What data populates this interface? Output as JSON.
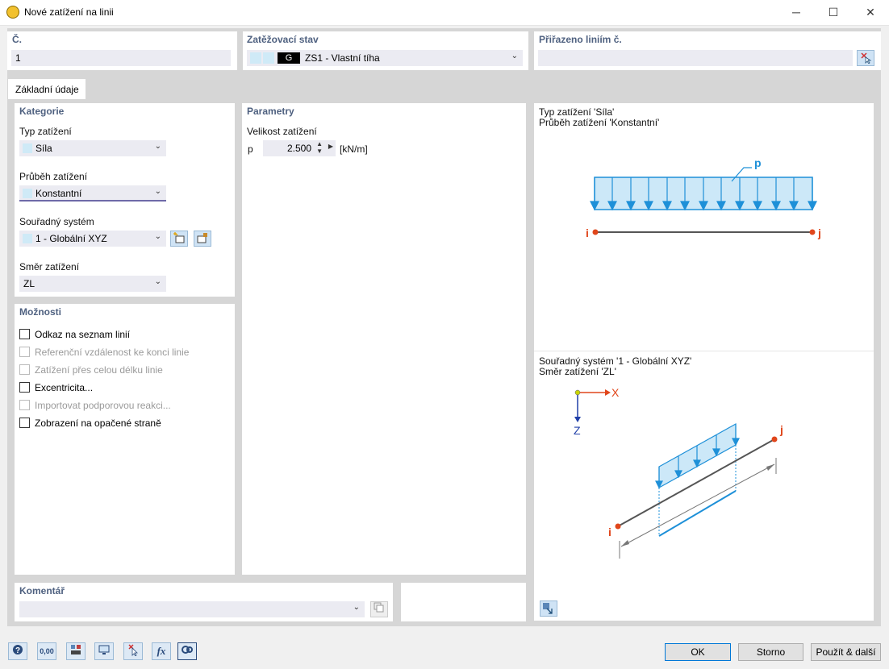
{
  "window": {
    "title": "Nové zatížení na linii",
    "minimize": "─",
    "maximize": "☐",
    "close": "✕"
  },
  "header": {
    "no_label": "Č.",
    "no_value": "1",
    "loadcase_label": "Zatěžovací stav",
    "loadcase_tag": "G",
    "loadcase_value": "ZS1 - Vlastní tíha",
    "assigned_label": "Přiřazeno liniím č.",
    "assigned_value": ""
  },
  "tab": {
    "label": "Základní údaje"
  },
  "category": {
    "title": "Kategorie",
    "load_type_label": "Typ zatížení",
    "load_type_value": "Síla",
    "distribution_label": "Průběh zatížení",
    "distribution_value": "Konstantní",
    "coord_label": "Souřadný systém",
    "coord_value": "1 - Globální XYZ",
    "direction_label": "Směr zatížení",
    "direction_value": "ZL"
  },
  "options": {
    "title": "Možnosti",
    "items": [
      {
        "label": "Odkaz na seznam linií",
        "enabled": true
      },
      {
        "label": "Referenční vzdálenost ke konci linie",
        "enabled": false
      },
      {
        "label": "Zatížení přes celou délku linie",
        "enabled": false
      },
      {
        "label": "Excentricita...",
        "enabled": true
      },
      {
        "label": "Importovat podporovou reakci...",
        "enabled": false
      },
      {
        "label": "Zobrazení na opačené straně",
        "enabled": true
      }
    ]
  },
  "parameters": {
    "title": "Parametry",
    "magnitude_label": "Velikost zatížení",
    "symbol": "p",
    "value": "2.500",
    "unit": "[kN/m]"
  },
  "preview": {
    "line1": "Typ zatížení 'Síla'",
    "line2": "Průběh zatížení 'Konstantní'",
    "line3": "Souřadný systém '1 - Globální XYZ'",
    "line4": "Směr zatížení 'ZL'",
    "p_label": "p",
    "i_label": "i",
    "j_label": "j",
    "x_axis": "X",
    "z_axis": "Z"
  },
  "comment": {
    "title": "Komentář",
    "value": ""
  },
  "footer": {
    "ok": "OK",
    "cancel": "Storno",
    "apply_next": "Použít & další",
    "tool_icons": [
      "help-icon",
      "decimal-icon",
      "units-icon",
      "view-icon",
      "cursor-icon",
      "function-icon",
      "settings-icon"
    ],
    "decimal_text": "0,00",
    "fx_text": "fx"
  },
  "colors": {
    "accent_blue": "#1e90d8",
    "node_red": "#e0461b",
    "label_blue": "#4f6180"
  }
}
